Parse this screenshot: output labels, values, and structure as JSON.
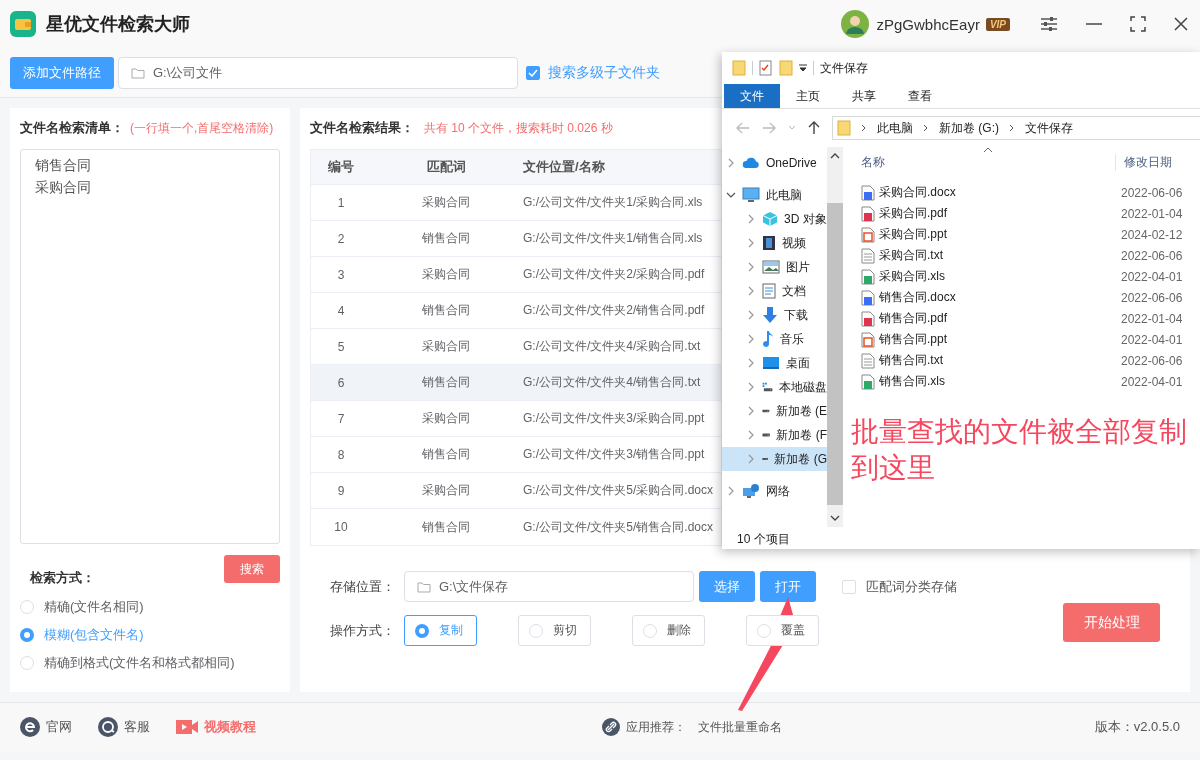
{
  "app": {
    "title": "星优文件检索大师",
    "user": {
      "name": "zPgGwbhcEayr",
      "badge": "VIP"
    }
  },
  "toolbar": {
    "add_button": "添加文件路径",
    "path": "G:\\公司文件",
    "subfolders": {
      "label": "搜索多级子文件夹",
      "checked": true
    }
  },
  "search_list": {
    "title": "文件名检索清单：",
    "hint": "(一行填一个,首尾空格清除)",
    "lines": [
      "销售合同",
      "采购合同"
    ],
    "search_button": "搜索",
    "mode_label": "检索方式：",
    "modes": [
      {
        "label": "精确(文件名相同)",
        "selected": false
      },
      {
        "label": "模糊(包含文件名)",
        "selected": true
      },
      {
        "label": "精确到格式(文件名和格式都相同)",
        "selected": false
      }
    ]
  },
  "results": {
    "title": "文件名检索结果：",
    "summary": "共有 10 个文件，搜索耗时 0.026 秒",
    "columns": [
      "编号",
      "匹配词",
      "文件位置/名称"
    ],
    "rows": [
      {
        "cells": [
          "1",
          "采购合同",
          "G:/公司文件/文件夹1/采购合同.xls"
        ],
        "selected": false
      },
      {
        "cells": [
          "2",
          "销售合同",
          "G:/公司文件/文件夹1/销售合同.xls"
        ],
        "selected": false
      },
      {
        "cells": [
          "3",
          "采购合同",
          "G:/公司文件/文件夹2/采购合同.pdf"
        ],
        "selected": false
      },
      {
        "cells": [
          "4",
          "销售合同",
          "G:/公司文件/文件夹2/销售合同.pdf"
        ],
        "selected": false
      },
      {
        "cells": [
          "5",
          "采购合同",
          "G:/公司文件/文件夹4/采购合同.txt"
        ],
        "selected": false
      },
      {
        "cells": [
          "6",
          "销售合同",
          "G:/公司文件/文件夹4/销售合同.txt"
        ],
        "selected": true
      },
      {
        "cells": [
          "7",
          "采购合同",
          "G:/公司文件/文件夹3/采购合同.ppt"
        ],
        "selected": false
      },
      {
        "cells": [
          "8",
          "销售合同",
          "G:/公司文件/文件夹3/销售合同.ppt"
        ],
        "selected": false
      },
      {
        "cells": [
          "9",
          "采购合同",
          "G:/公司文件/文件夹5/采购合同.docx"
        ],
        "selected": false
      },
      {
        "cells": [
          "10",
          "销售合同",
          "G:/公司文件/文件夹5/销售合同.docx"
        ],
        "selected": false
      }
    ]
  },
  "output": {
    "location_label": "存储位置：",
    "location": "G:\\文件保存",
    "choose_button": "选择",
    "open_button": "打开",
    "classify": {
      "label": "匹配词分类存储",
      "checked": false
    },
    "operation_label": "操作方式：",
    "operations": [
      {
        "label": "复制",
        "selected": true
      },
      {
        "label": "剪切",
        "selected": false
      },
      {
        "label": "删除",
        "selected": false
      },
      {
        "label": "覆盖",
        "selected": false
      }
    ],
    "start_button": "开始处理"
  },
  "footer": {
    "links": [
      {
        "label": "官网",
        "kind": "web"
      },
      {
        "label": "客服",
        "kind": "chat"
      },
      {
        "label": "视频教程",
        "kind": "video"
      }
    ],
    "recommend_label": "应用推荐：",
    "recommend_app": "文件批量重命名",
    "version": "版本：v2.0.5.0"
  },
  "explorer": {
    "title": "文件保存",
    "ribbon_tabs": [
      {
        "label": "文件",
        "selected": true
      },
      {
        "label": "主页",
        "selected": false
      },
      {
        "label": "共享",
        "selected": false
      },
      {
        "label": "查看",
        "selected": false
      }
    ],
    "breadcrumb": [
      "此电脑",
      "新加卷 (G:)",
      "文件保存"
    ],
    "nav": [
      {
        "label": "OneDrive",
        "kind": "cloud",
        "expanded": false,
        "selected": false
      },
      {
        "label": "此电脑",
        "kind": "computer",
        "expanded": true,
        "selected": false,
        "children": [
          {
            "label": "3D 对象",
            "kind": "cube",
            "expanded": false,
            "selected": false
          },
          {
            "label": "视频",
            "kind": "video",
            "expanded": false,
            "selected": false
          },
          {
            "label": "图片",
            "kind": "picture",
            "expanded": false,
            "selected": false
          },
          {
            "label": "文档",
            "kind": "document",
            "expanded": false,
            "selected": false
          },
          {
            "label": "下载",
            "kind": "download",
            "expanded": false,
            "selected": false
          },
          {
            "label": "音乐",
            "kind": "music",
            "expanded": false,
            "selected": false
          },
          {
            "label": "桌面",
            "kind": "desktop",
            "expanded": false,
            "selected": false
          },
          {
            "label": "本地磁盘",
            "kind": "system-drive",
            "expanded": false,
            "selected": false
          },
          {
            "label": "新加卷 (E",
            "kind": "drive",
            "expanded": false,
            "selected": false
          },
          {
            "label": "新加卷 (F",
            "kind": "drive",
            "expanded": false,
            "selected": false
          },
          {
            "label": "新加卷 (G",
            "kind": "drive",
            "expanded": false,
            "selected": true
          }
        ]
      },
      {
        "label": "网络",
        "kind": "network",
        "expanded": false,
        "selected": false
      }
    ],
    "columns": [
      "名称",
      "修改日期"
    ],
    "files": [
      {
        "name": "采购合同.docx",
        "kind": "word",
        "date": "2022-06-06"
      },
      {
        "name": "采购合同.pdf",
        "kind": "pdf",
        "date": "2022-01-04"
      },
      {
        "name": "采购合同.ppt",
        "kind": "ppt",
        "date": "2024-02-12"
      },
      {
        "name": "采购合同.txt",
        "kind": "text",
        "date": "2022-06-06"
      },
      {
        "name": "采购合同.xls",
        "kind": "sheet",
        "date": "2022-04-01"
      },
      {
        "name": "销售合同.docx",
        "kind": "word",
        "date": "2022-06-06"
      },
      {
        "name": "销售合同.pdf",
        "kind": "pdf",
        "date": "2022-01-04"
      },
      {
        "name": "销售合同.ppt",
        "kind": "ppt",
        "date": "2022-04-01"
      },
      {
        "name": "销售合同.txt",
        "kind": "text",
        "date": "2022-06-06"
      },
      {
        "name": "销售合同.xls",
        "kind": "sheet",
        "date": "2022-04-01"
      }
    ],
    "status": "10 个项目"
  },
  "annotation": {
    "text": "批量查找的文件被全部复制到这里"
  }
}
